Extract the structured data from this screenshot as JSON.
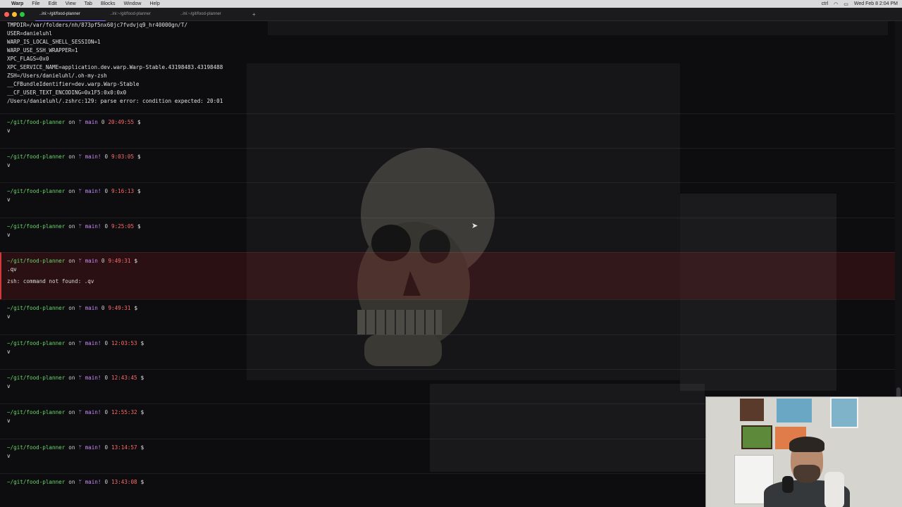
{
  "menubar": {
    "items": [
      "Warp",
      "File",
      "Edit",
      "View",
      "Tab",
      "Blocks",
      "Window",
      "Help"
    ],
    "clock": "Wed Feb 8  2:04 PM",
    "status_text": "ctrl"
  },
  "tabs": [
    {
      "label": "..ini:~/git/food-planner",
      "active": true
    },
    {
      "label": "..ini:~/git/food-planner",
      "active": false
    },
    {
      "label": "..ini:~/git/food-planner",
      "active": false
    }
  ],
  "new_tab_label": "+",
  "env_lines": [
    "TMPDIR=/var/folders/nh/873pf5nx60jc7fvdvjq9_hr40000gn/T/",
    "USER=danieluhl",
    "WARP_IS_LOCAL_SHELL_SESSION=1",
    "WARP_USE_SSH_WRAPPER=1",
    "XPC_FLAGS=0x0",
    "XPC_SERVICE_NAME=application.dev.warp.Warp-Stable.43198483.43198488",
    "ZSH=/Users/danieluhl/.oh-my-zsh",
    "__CFBundleIdentifier=dev.warp.Warp-Stable",
    "__CF_USER_TEXT_ENCODING=0x1F5:0x0:0x0",
    "/Users/danieluhl/.zshrc:129: parse error: condition expected: 20:01"
  ],
  "blocks": [
    {
      "cwd": "~/git/food-planner",
      "on": "on",
      "branch": "main",
      "dirty": "",
      "status": "0",
      "time": "20:49:55",
      "symbol": "$",
      "cmd": "v",
      "output": "",
      "error": false
    },
    {
      "cwd": "~/git/food-planner",
      "on": "on",
      "branch": "main",
      "dirty": "!",
      "status": "0",
      "time": "9:03:05",
      "symbol": "$",
      "cmd": "v",
      "output": "",
      "error": false
    },
    {
      "cwd": "~/git/food-planner",
      "on": "on",
      "branch": "main",
      "dirty": "!",
      "status": "0",
      "time": "9:16:13",
      "symbol": "$",
      "cmd": "v",
      "output": "",
      "error": false
    },
    {
      "cwd": "~/git/food-planner",
      "on": "on",
      "branch": "main",
      "dirty": "!",
      "status": "0",
      "time": "9:25:05",
      "symbol": "$",
      "cmd": "v",
      "output": "",
      "error": false
    },
    {
      "cwd": "~/git/food-planner",
      "on": "on",
      "branch": "main",
      "dirty": "",
      "status": "0",
      "time": "9:49:31",
      "symbol": "$",
      "cmd": ".qv",
      "output": "zsh: command not found: .qv",
      "error": true
    },
    {
      "cwd": "~/git/food-planner",
      "on": "on",
      "branch": "main",
      "dirty": "",
      "status": "0",
      "time": "9:49:31",
      "symbol": "$",
      "cmd": "v",
      "output": "",
      "error": false
    },
    {
      "cwd": "~/git/food-planner",
      "on": "on",
      "branch": "main",
      "dirty": "!",
      "status": "0",
      "time": "12:03:53",
      "symbol": "$",
      "cmd": "v",
      "output": "",
      "error": false
    },
    {
      "cwd": "~/git/food-planner",
      "on": "on",
      "branch": "main",
      "dirty": "!",
      "status": "0",
      "time": "12:43:45",
      "symbol": "$",
      "cmd": "v",
      "output": "",
      "error": false
    },
    {
      "cwd": "~/git/food-planner",
      "on": "on",
      "branch": "main",
      "dirty": "!",
      "status": "0",
      "time": "12:55:32",
      "symbol": "$",
      "cmd": "v",
      "output": "",
      "error": false
    },
    {
      "cwd": "~/git/food-planner",
      "on": "on",
      "branch": "main",
      "dirty": "!",
      "status": "0",
      "time": "13:14:57",
      "symbol": "$",
      "cmd": "v",
      "output": "",
      "error": false
    },
    {
      "cwd": "~/git/food-planner",
      "on": "on",
      "branch": "main",
      "dirty": "!",
      "status": "0",
      "time": "13:43:08",
      "symbol": "$",
      "cmd": "",
      "output": "",
      "error": false
    }
  ],
  "colors": {
    "cwd": "#6bd46b",
    "branch": "#c58af0",
    "time": "#ff6b6b",
    "error_bg": "#3a1517",
    "accent": "#8a6cff"
  },
  "icons": [
    "apple-icon",
    "branch-icon",
    "cursor-arrow-icon",
    "wifi-icon",
    "battery-icon"
  ]
}
